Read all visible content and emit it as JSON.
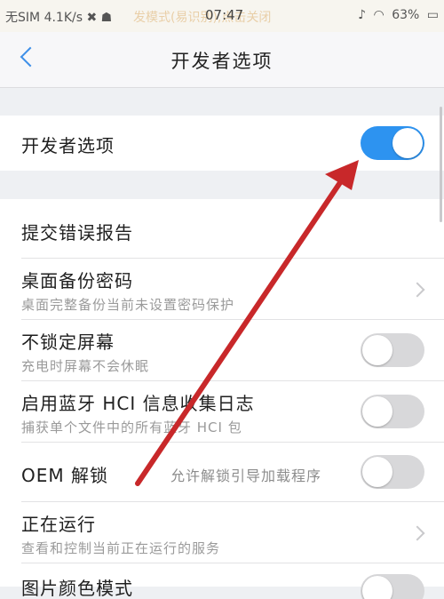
{
  "status_bar": {
    "carrier": "无SIM",
    "speed": "4.1K/s",
    "notice": "发模式(易识别),点击关闭",
    "time": "07:47",
    "battery": "63%"
  },
  "header": {
    "title": "开发者选项"
  },
  "master_toggle": {
    "label": "开发者选项",
    "on": true
  },
  "items": [
    {
      "title": "提交错误报告"
    },
    {
      "title": "桌面备份密码",
      "subtitle": "桌面完整备份当前未设置密码保护"
    },
    {
      "title": "不锁定屏幕",
      "subtitle": "充电时屏幕不会休眠",
      "on": false
    },
    {
      "title": "启用蓝牙 HCI 信息收集日志",
      "subtitle": "捕获单个文件中的所有蓝牙 HCI 包",
      "on": false
    },
    {
      "title": "OEM 解锁",
      "note": "允许解锁引导加载程序",
      "on": false
    },
    {
      "title": "正在运行",
      "subtitle": "查看和控制当前正在运行的服务"
    },
    {
      "title": "图片颜色模式"
    }
  ],
  "colors": {
    "accent": "#2d93f0",
    "annotation": "#c8282a"
  }
}
